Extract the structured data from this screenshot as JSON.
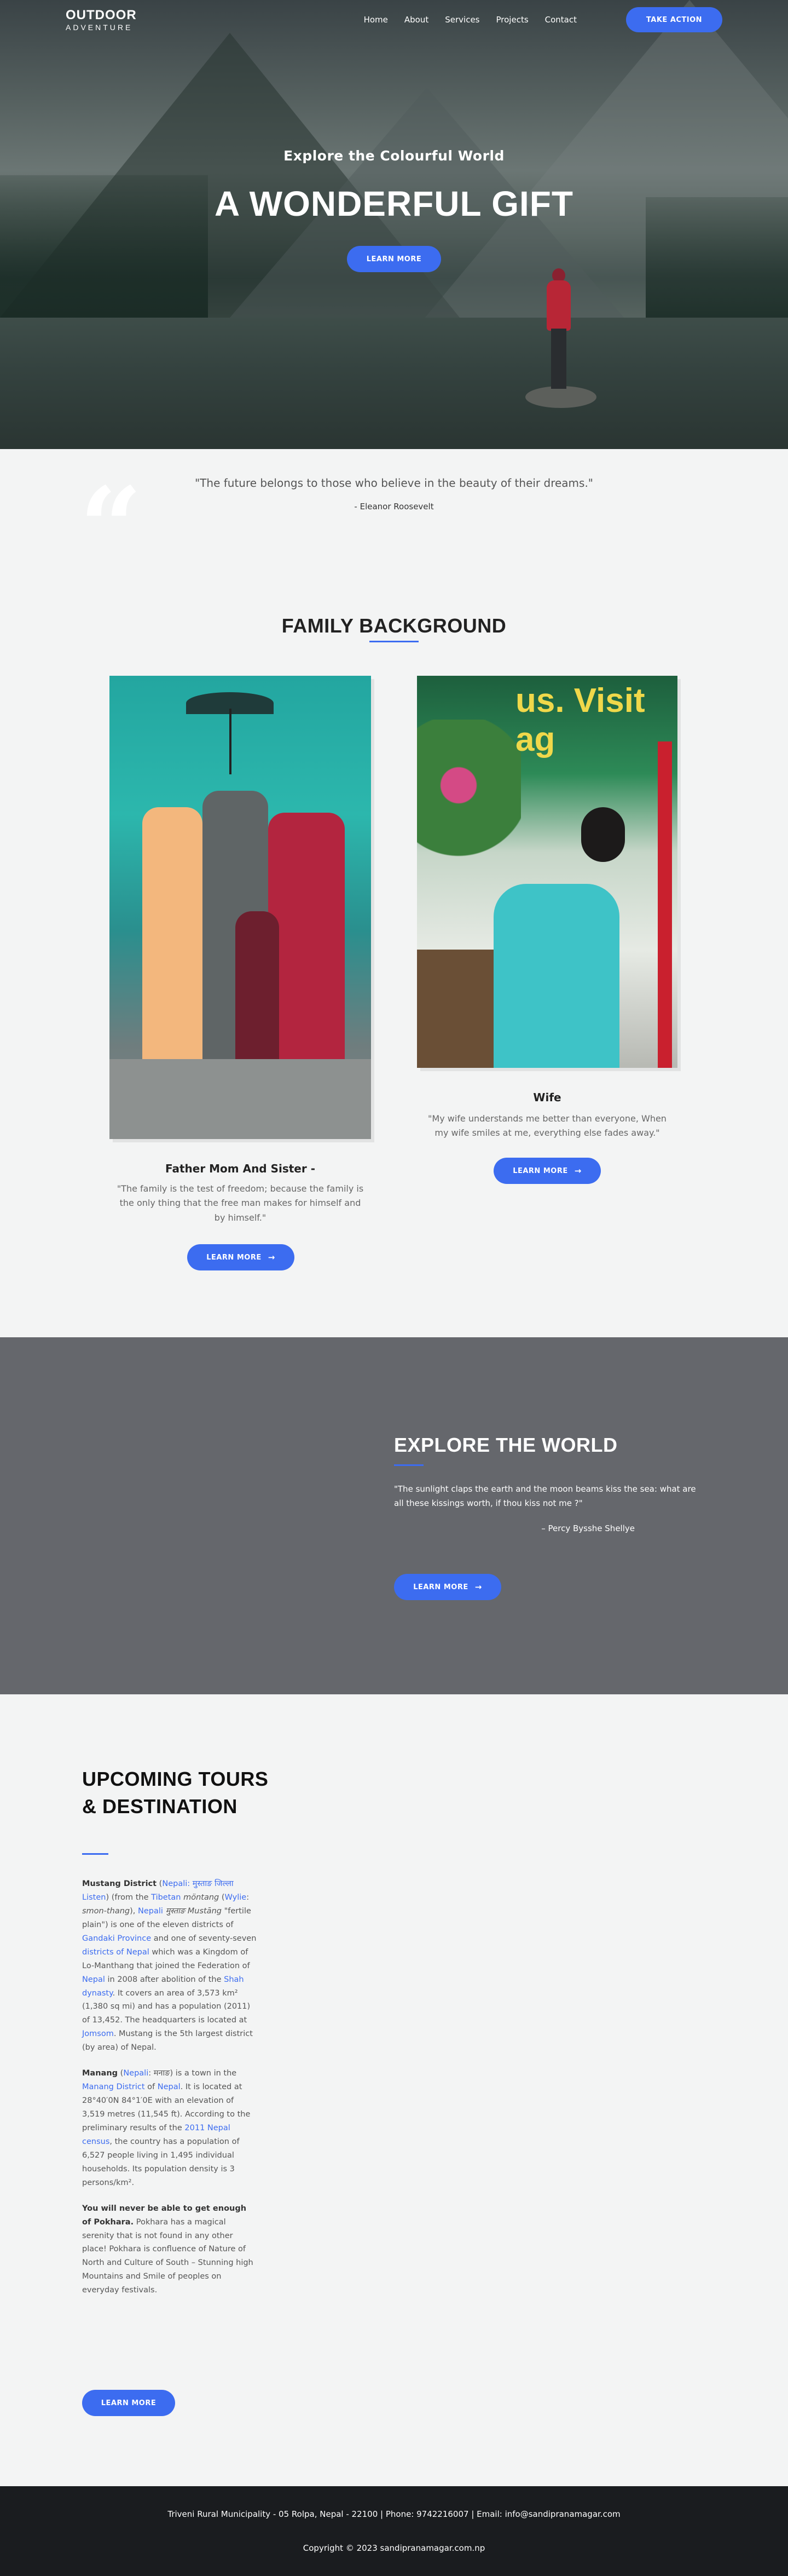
{
  "nav": {
    "logo_top": "OUTDOOR",
    "logo_bottom": "ADVENTURE",
    "items": [
      "Home",
      "About",
      "Services",
      "Projects",
      "Contact"
    ],
    "cta": "TAKE ACTION"
  },
  "hero": {
    "subtitle": "Explore the Colourful World",
    "title": "A WONDERFUL GIFT",
    "button": "LEARN MORE"
  },
  "quote": {
    "mark": "“",
    "text": "\"The future belongs to those who believe in the beauty of their dreams.\"",
    "author": "- Eleanor Roosevelt"
  },
  "family": {
    "title": "FAMILY BACKGROUND",
    "card1": {
      "title": "Father Mom And Sister -",
      "text": "\"The family is the test of freedom; because the family is the only thing that the free man makes for himself and by himself.\"",
      "button": "LEARN MORE"
    },
    "card2": {
      "sign": "us. Visit ag",
      "title": "Wife",
      "text": "\"My wife understands me better than everyone, When my wife smiles at me, everything else fades away.\"",
      "button": "LEARN MORE"
    },
    "arrow": "→"
  },
  "explore": {
    "title": "EXPLORE THE WORLD",
    "text": "\"The sunlight claps the earth and the moon beams kiss the sea: what are all these kissings worth, if thou kiss not me ?\"",
    "author": "– Percy Bysshe Shellye",
    "button": "LEARN MORE"
  },
  "tours": {
    "title": "UPCOMING TOURS & DESTINATION",
    "button": "LEARN MORE"
  },
  "footer": {
    "line1": "Triveni Rural Municipality - 05 Rolpa, Nepal - 22100 | Phone: 9742216007 | Email: info@sandipranamagar.com",
    "line2": "Copyright © 2023 sandipranamagar.com.np"
  }
}
